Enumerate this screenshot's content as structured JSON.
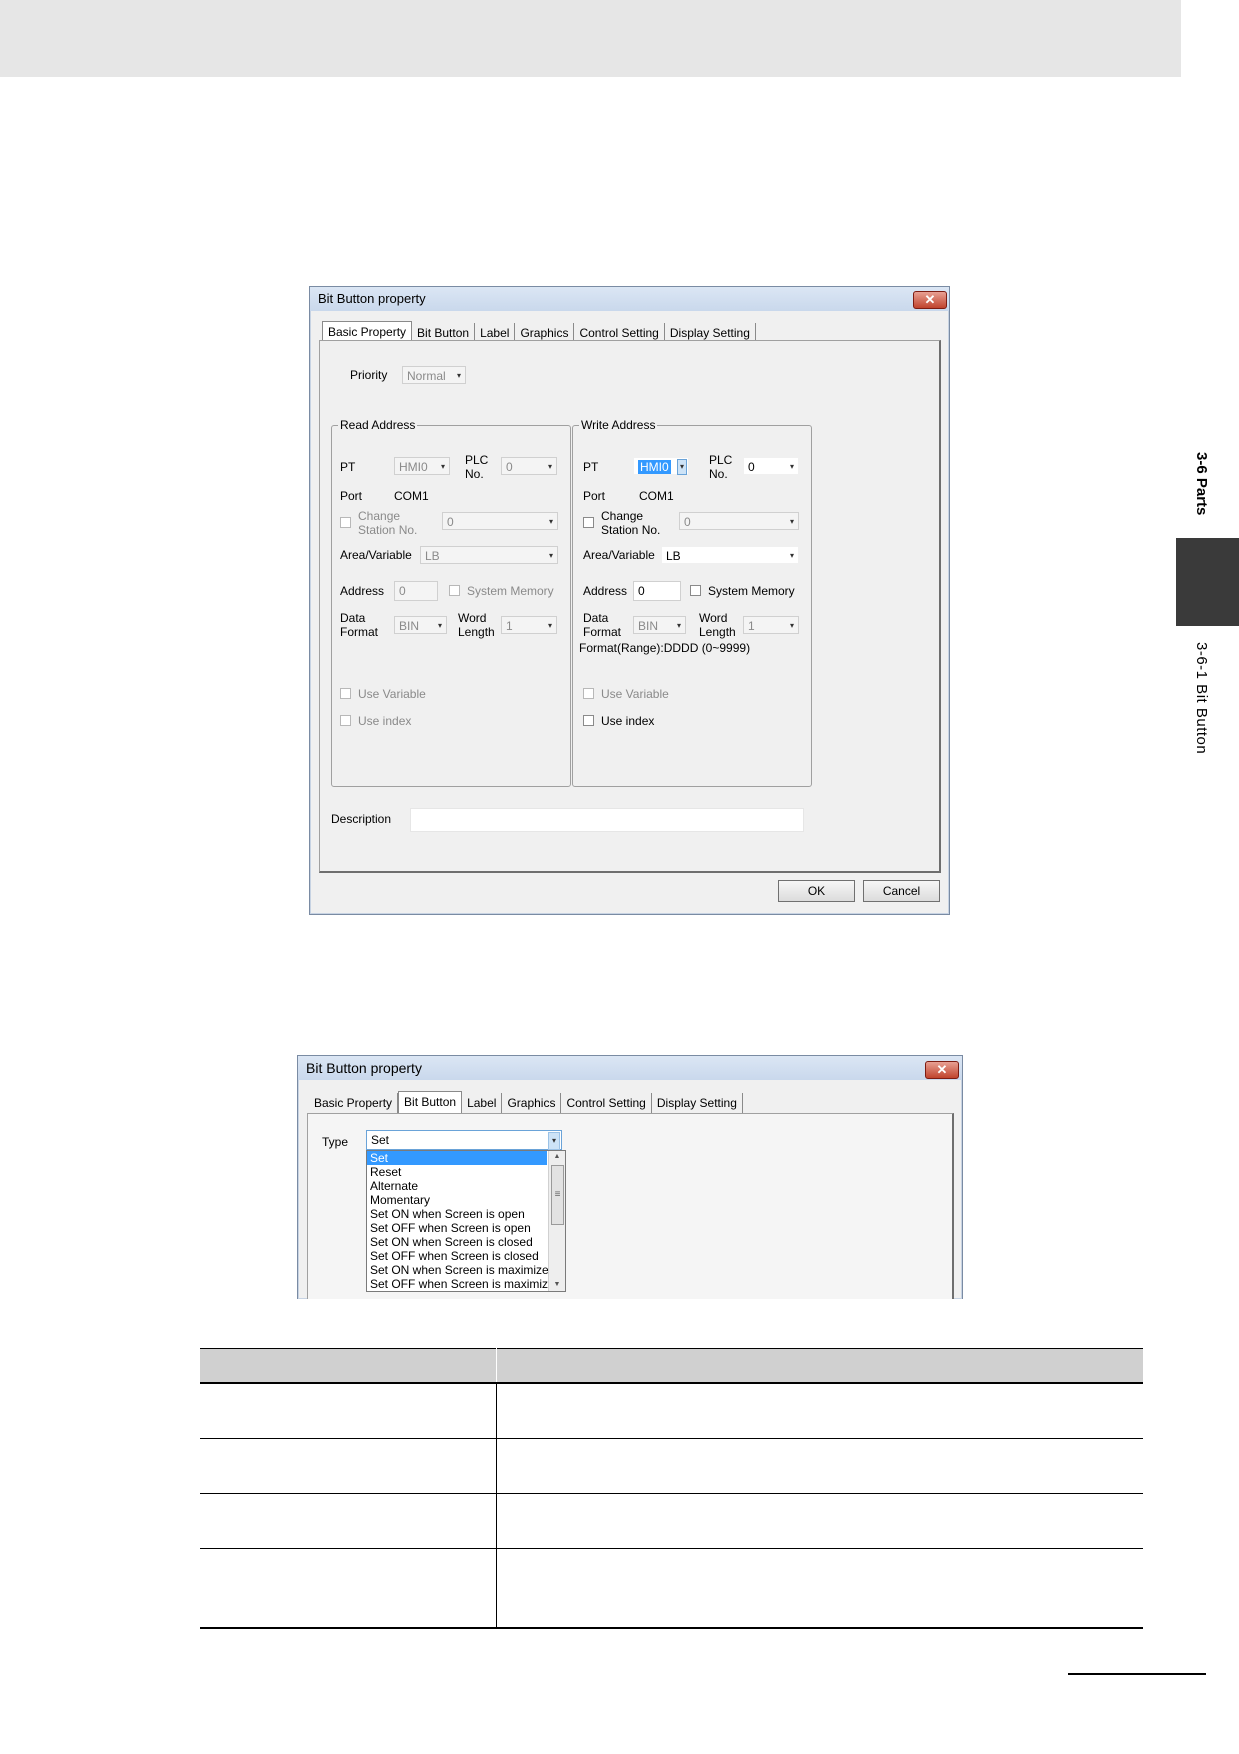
{
  "side": {
    "section": "3-6 Parts",
    "subsection": "3-6-1  Bit Button"
  },
  "dialog1": {
    "title": "Bit Button property",
    "close": "✕",
    "tabs": [
      "Basic Property",
      "Bit Button",
      "Label",
      "Graphics",
      "Control Setting",
      "Display Setting"
    ],
    "priority_label": "Priority",
    "priority_value": "Normal",
    "read": {
      "title": "Read Address",
      "pt_label": "PT",
      "pt_value": "HMI0",
      "plc_label_1": "PLC",
      "plc_label_2": "No.",
      "plc_value": "0",
      "port_label": "Port",
      "port_value": "COM1",
      "change_1": "Change",
      "change_2": "Station No.",
      "station_value": "0",
      "area_label": "Area/Variable",
      "area_value": "LB",
      "address_label": "Address",
      "address_value": "0",
      "sysmem_label": "System Memory",
      "data_1": "Data",
      "data_2": "Format",
      "format_value": "BIN",
      "word_1": "Word",
      "word_2": "Length",
      "length_value": "1",
      "use_variable": "Use Variable",
      "use_index": "Use index"
    },
    "write": {
      "title": "Write Address",
      "pt_label": "PT",
      "pt_value": "HMI0",
      "plc_label_1": "PLC",
      "plc_label_2": "No.",
      "plc_value": "0",
      "port_label": "Port",
      "port_value": "COM1",
      "change_1": "Change",
      "change_2": "Station No.",
      "station_value": "0",
      "area_label": "Area/Variable",
      "area_value": "LB",
      "address_label": "Address",
      "address_value": "0",
      "sysmem_label": "System Memory",
      "data_1": "Data",
      "data_2": "Format",
      "format_value": "BIN",
      "word_1": "Word",
      "word_2": "Length",
      "length_value": "1",
      "format_range": "Format(Range):DDDD (0~9999)",
      "use_variable": "Use Variable",
      "use_index": "Use index"
    },
    "description_label": "Description",
    "ok": "OK",
    "cancel": "Cancel"
  },
  "dialog2": {
    "title": "Bit Button property",
    "close": "✕",
    "tabs": [
      "Basic Property",
      "Bit Button",
      "Label",
      "Graphics",
      "Control Setting",
      "Display Setting"
    ],
    "type_label": "Type",
    "type_value": "Set",
    "options": [
      "Set",
      "Reset",
      "Alternate",
      "Momentary",
      "Set ON when Screen is open",
      "Set OFF when Screen is open",
      "Set ON when Screen is closed",
      "Set OFF when Screen is closed",
      "Set ON when Screen is maximized",
      "Set OFF when Screen is maximized"
    ]
  },
  "icons": {
    "dropdown": "▾",
    "scroll_up": "▲",
    "scroll_down": "▼",
    "scroll_grip": "≡"
  }
}
